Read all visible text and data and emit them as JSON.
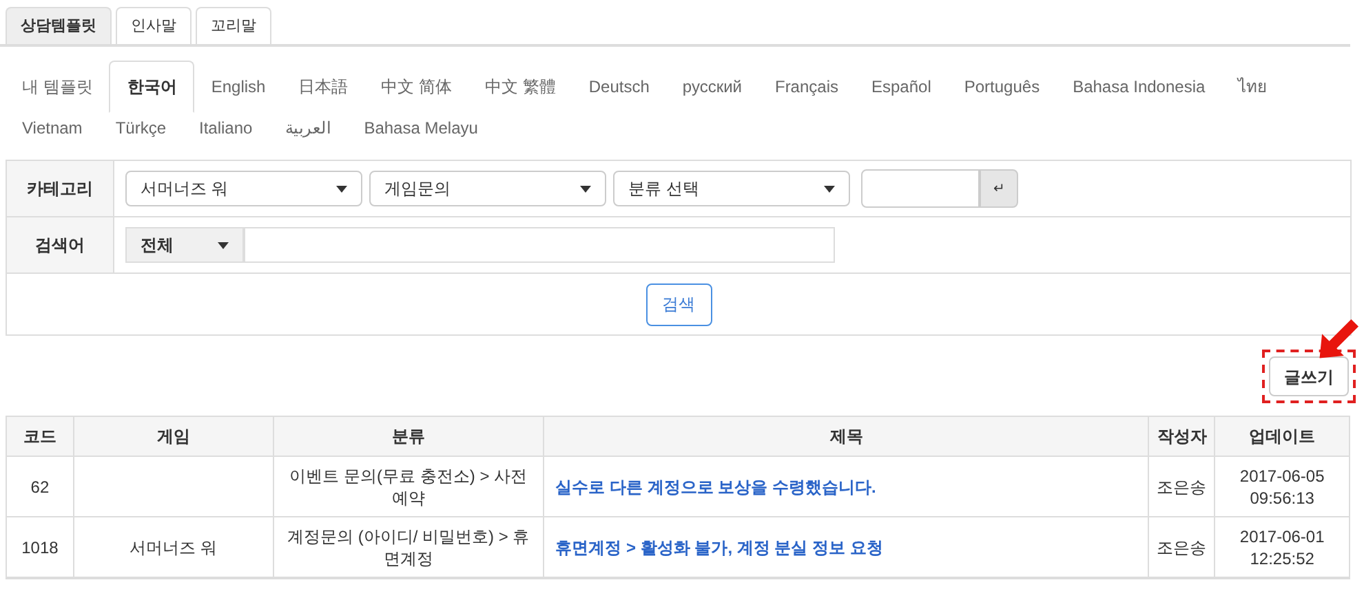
{
  "top_tabs": [
    {
      "label": "상담템플릿",
      "selected": true
    },
    {
      "label": "인사말",
      "selected": false
    },
    {
      "label": "꼬리말",
      "selected": false
    }
  ],
  "language_tabs": [
    {
      "label": "내 템플릿",
      "selected": false
    },
    {
      "label": "한국어",
      "selected": true
    },
    {
      "label": "English",
      "selected": false
    },
    {
      "label": "日本語",
      "selected": false
    },
    {
      "label": "中文 简体",
      "selected": false
    },
    {
      "label": "中文 繁體",
      "selected": false
    },
    {
      "label": "Deutsch",
      "selected": false
    },
    {
      "label": "русский",
      "selected": false
    },
    {
      "label": "Français",
      "selected": false
    },
    {
      "label": "Español",
      "selected": false
    },
    {
      "label": "Português",
      "selected": false
    },
    {
      "label": "Bahasa Indonesia",
      "selected": false
    },
    {
      "label": "ไทย",
      "selected": false
    },
    {
      "label": "Vietnam",
      "selected": false
    },
    {
      "label": "Türkçe",
      "selected": false
    },
    {
      "label": "Italiano",
      "selected": false
    },
    {
      "label": "العربية",
      "selected": false
    },
    {
      "label": "Bahasa Melayu",
      "selected": false
    }
  ],
  "search_form": {
    "category_label": "카테고리",
    "category_selects": [
      "서머너즈 워",
      "게임문의",
      "분류 선택"
    ],
    "enter_button": "↵",
    "keyword_label": "검색어",
    "keyword_scope": "전체",
    "search_button": "검색"
  },
  "write_button": "글쓰기",
  "table": {
    "columns": [
      "코드",
      "게임",
      "분류",
      "제목",
      "작성자",
      "업데이트"
    ],
    "rows": [
      {
        "code": "62",
        "game": "",
        "category": "이벤트 문의(무료 충전소) > 사전예약",
        "title": "실수로 다른 계정으로 보상을 수령했습니다.",
        "author": "조은송",
        "updated": [
          "2017-06-05",
          "09:56:13"
        ]
      },
      {
        "code": "1018",
        "game": "서머너즈 워",
        "category": "계정문의 (아이디/ 비밀번호) > 휴면계정",
        "title": "휴면계정 > 활성화 불가, 계정 분실 정보 요청",
        "author": "조은송",
        "updated": [
          "2017-06-01",
          "12:25:52"
        ]
      }
    ]
  }
}
